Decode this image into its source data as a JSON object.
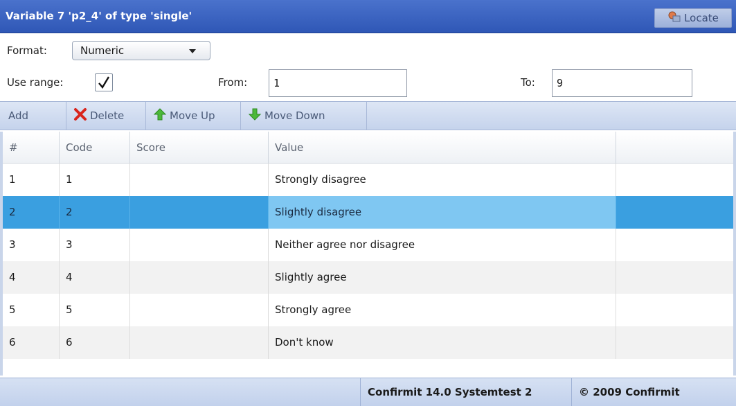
{
  "titlebar": {
    "title": "Variable 7 'p2_4' of type 'single'",
    "locate_label": "Locate",
    "locate_icon": "locate-icon"
  },
  "format": {
    "label": "Format:",
    "value": "Numeric"
  },
  "range": {
    "use_label": "Use range:",
    "checked": true,
    "from_label": "From:",
    "from_value": "1",
    "to_label": "To:",
    "to_value": "9"
  },
  "toolbar": {
    "add_label": "Add",
    "delete_label": "Delete",
    "move_up_label": "Move Up",
    "move_down_label": "Move Down"
  },
  "grid": {
    "columns": [
      "#",
      "Code",
      "Score",
      "Value",
      ""
    ],
    "rows": [
      {
        "num": "1",
        "code": "1",
        "score": "",
        "value": "Strongly disagree"
      },
      {
        "num": "2",
        "code": "2",
        "score": "",
        "value": "Slightly disagree"
      },
      {
        "num": "3",
        "code": "3",
        "score": "",
        "value": "Neither agree nor disagree"
      },
      {
        "num": "4",
        "code": "4",
        "score": "",
        "value": "Slightly agree"
      },
      {
        "num": "5",
        "code": "5",
        "score": "",
        "value": "Strongly agree"
      },
      {
        "num": "6",
        "code": "6",
        "score": "",
        "value": "Don't know"
      }
    ],
    "selected_row": "2"
  },
  "status": {
    "version": "Confirmit 14.0 Systemtest 2",
    "copyright": "© 2009 Confirmit"
  },
  "colors": {
    "titlebar": "#2f57b6",
    "selection": "#3a9fe0",
    "selection_value": "#7fc7f2",
    "delete_icon": "#d9251d",
    "arrow_icon": "#4cb83a"
  }
}
